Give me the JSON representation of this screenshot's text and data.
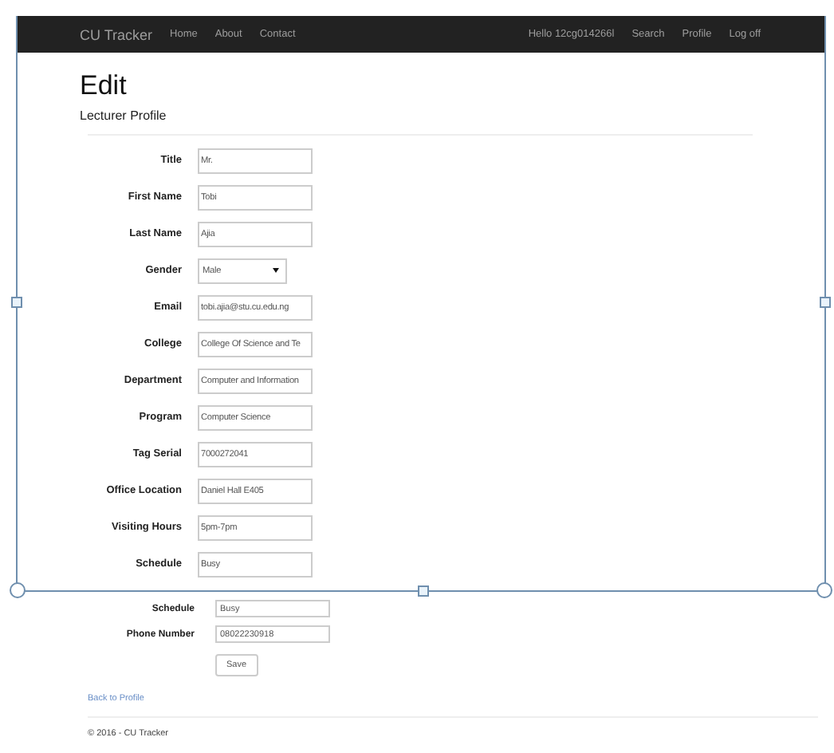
{
  "navbar": {
    "brand": "CU Tracker",
    "links": [
      "Home",
      "About",
      "Contact"
    ],
    "user_links": [
      "Hello 12cg014266l",
      "Search",
      "Profile",
      "Log off"
    ]
  },
  "heading": "Edit",
  "subheading": "Lecturer Profile",
  "form": {
    "fields": [
      {
        "label": "Title",
        "kind": "text",
        "value": "Mr."
      },
      {
        "label": "First Name",
        "kind": "text",
        "value": "Tobi"
      },
      {
        "label": "Last Name",
        "kind": "text",
        "value": "Ajia"
      },
      {
        "label": "Gender",
        "kind": "select",
        "value": "Male"
      },
      {
        "label": "Email",
        "kind": "text",
        "value": "tobi.ajia@stu.cu.edu.ng"
      },
      {
        "label": "College",
        "kind": "text",
        "value": "College Of Science and Te"
      },
      {
        "label": "Department",
        "kind": "text",
        "value": "Computer and Information"
      },
      {
        "label": "Program",
        "kind": "text",
        "value": "Computer Science"
      },
      {
        "label": "Tag Serial",
        "kind": "text",
        "value": "7000272041"
      },
      {
        "label": "Office Location",
        "kind": "text",
        "value": "Daniel Hall E405"
      },
      {
        "label": "Visiting Hours",
        "kind": "text",
        "value": "5pm-7pm"
      },
      {
        "label": "Schedule",
        "kind": "text",
        "value": "Busy"
      }
    ]
  },
  "lower_form": {
    "fields": [
      {
        "label": "Schedule",
        "kind": "text",
        "value": "Busy"
      },
      {
        "label": "Phone Number",
        "kind": "text",
        "value": "08022230918"
      }
    ],
    "save_button": "Save"
  },
  "back_link": "Back to Profile",
  "footer": "© 2016 - CU Tracker"
}
